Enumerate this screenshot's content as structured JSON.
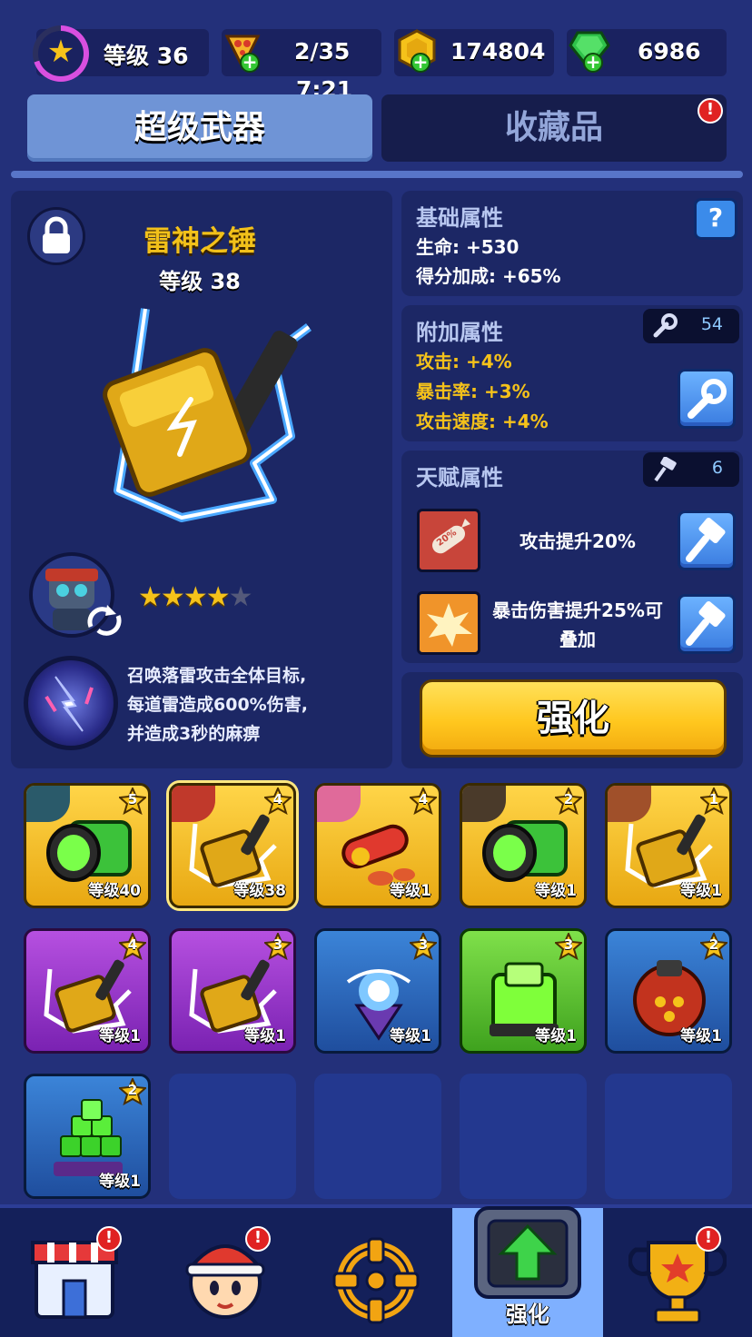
{
  "resources": {
    "level_label": "等级 36",
    "pizza_count": "2/35",
    "timer": "7:21",
    "coins": "174804",
    "gems": "6986"
  },
  "tabs": [
    {
      "label": "超级武器",
      "active": true
    },
    {
      "label": "收藏品",
      "active": false,
      "alert": "!"
    }
  ],
  "weapon": {
    "name": "雷神之锤",
    "level": "等级 38",
    "stars_filled": 4,
    "stars_total": 5,
    "skill_description": [
      "召唤落雷攻击全体目标,",
      "每道雷造成600%伤害,",
      "并造成3秒的麻痹"
    ]
  },
  "base_attributes": {
    "title": "基础属性",
    "help": "?",
    "stats": [
      "生命: +530",
      "得分加成: +65%"
    ]
  },
  "bonus_attributes": {
    "title": "附加属性",
    "wrench_count": "54",
    "stats": [
      "攻击: +4%",
      "暴击率: +3%",
      "攻击速度: +4%"
    ]
  },
  "talent_attributes": {
    "title": "天赋属性",
    "hammer_count": "6",
    "talents": [
      "攻击提升20%",
      "暴击伤害提升25%可叠加"
    ],
    "rocket_badge": "20%"
  },
  "upgrade_button": "强化",
  "inventory": [
    {
      "rarity": "gold",
      "kind": "cannon",
      "stars": "5",
      "level": "等级40"
    },
    {
      "rarity": "gold",
      "kind": "hammer",
      "stars": "4",
      "level": "等级38",
      "selected": true
    },
    {
      "rarity": "gold",
      "kind": "rocket",
      "stars": "4",
      "level": "等级1"
    },
    {
      "rarity": "gold",
      "kind": "cannon",
      "stars": "2",
      "level": "等级1"
    },
    {
      "rarity": "gold",
      "kind": "hammer",
      "stars": "1",
      "level": "等级1"
    },
    {
      "rarity": "purple",
      "kind": "hammer",
      "stars": "4",
      "level": "等级1"
    },
    {
      "rarity": "purple",
      "kind": "hammer",
      "stars": "3",
      "level": "等级1"
    },
    {
      "rarity": "blue",
      "kind": "orb",
      "stars": "3",
      "level": "等级1"
    },
    {
      "rarity": "green",
      "kind": "cube",
      "stars": "3",
      "level": "等级1"
    },
    {
      "rarity": "blue",
      "kind": "bomb",
      "stars": "2",
      "level": "等级1"
    },
    {
      "rarity": "blue",
      "kind": "blocks",
      "stars": "2",
      "level": "等级1"
    }
  ],
  "nav": [
    {
      "icon": "shop-icon",
      "alert": "!"
    },
    {
      "icon": "hero-icon",
      "alert": "!"
    },
    {
      "icon": "target-icon"
    },
    {
      "icon": "upgrade-icon",
      "label": "强化",
      "active": true
    },
    {
      "icon": "trophy-icon",
      "alert": "!"
    }
  ],
  "colors": {
    "background": "#23307a",
    "panel": "#1c2765",
    "accent_yellow": "#f5c21a",
    "button_blue": "#3b8bea"
  }
}
